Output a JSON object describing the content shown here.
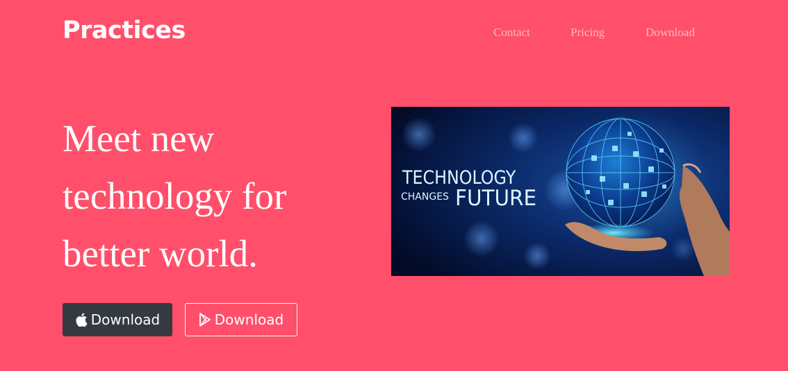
{
  "navbar": {
    "brand": "Practices",
    "links": [
      "Contact",
      "Pricing",
      "Download"
    ]
  },
  "hero": {
    "headline_lines": [
      "Meet new",
      "technology for",
      "better world."
    ],
    "buttons": {
      "apple": {
        "label": "Download",
        "icon": "apple-icon"
      },
      "play": {
        "label": "Download",
        "icon": "google-play-icon"
      }
    },
    "image": {
      "line1": "TECHNOLOGY",
      "line2_small": "CHANGES",
      "line2_large": "FUTURE"
    }
  },
  "colors": {
    "background": "#ff4f6a",
    "dark_button": "#343a40",
    "text": "#ffffff"
  }
}
